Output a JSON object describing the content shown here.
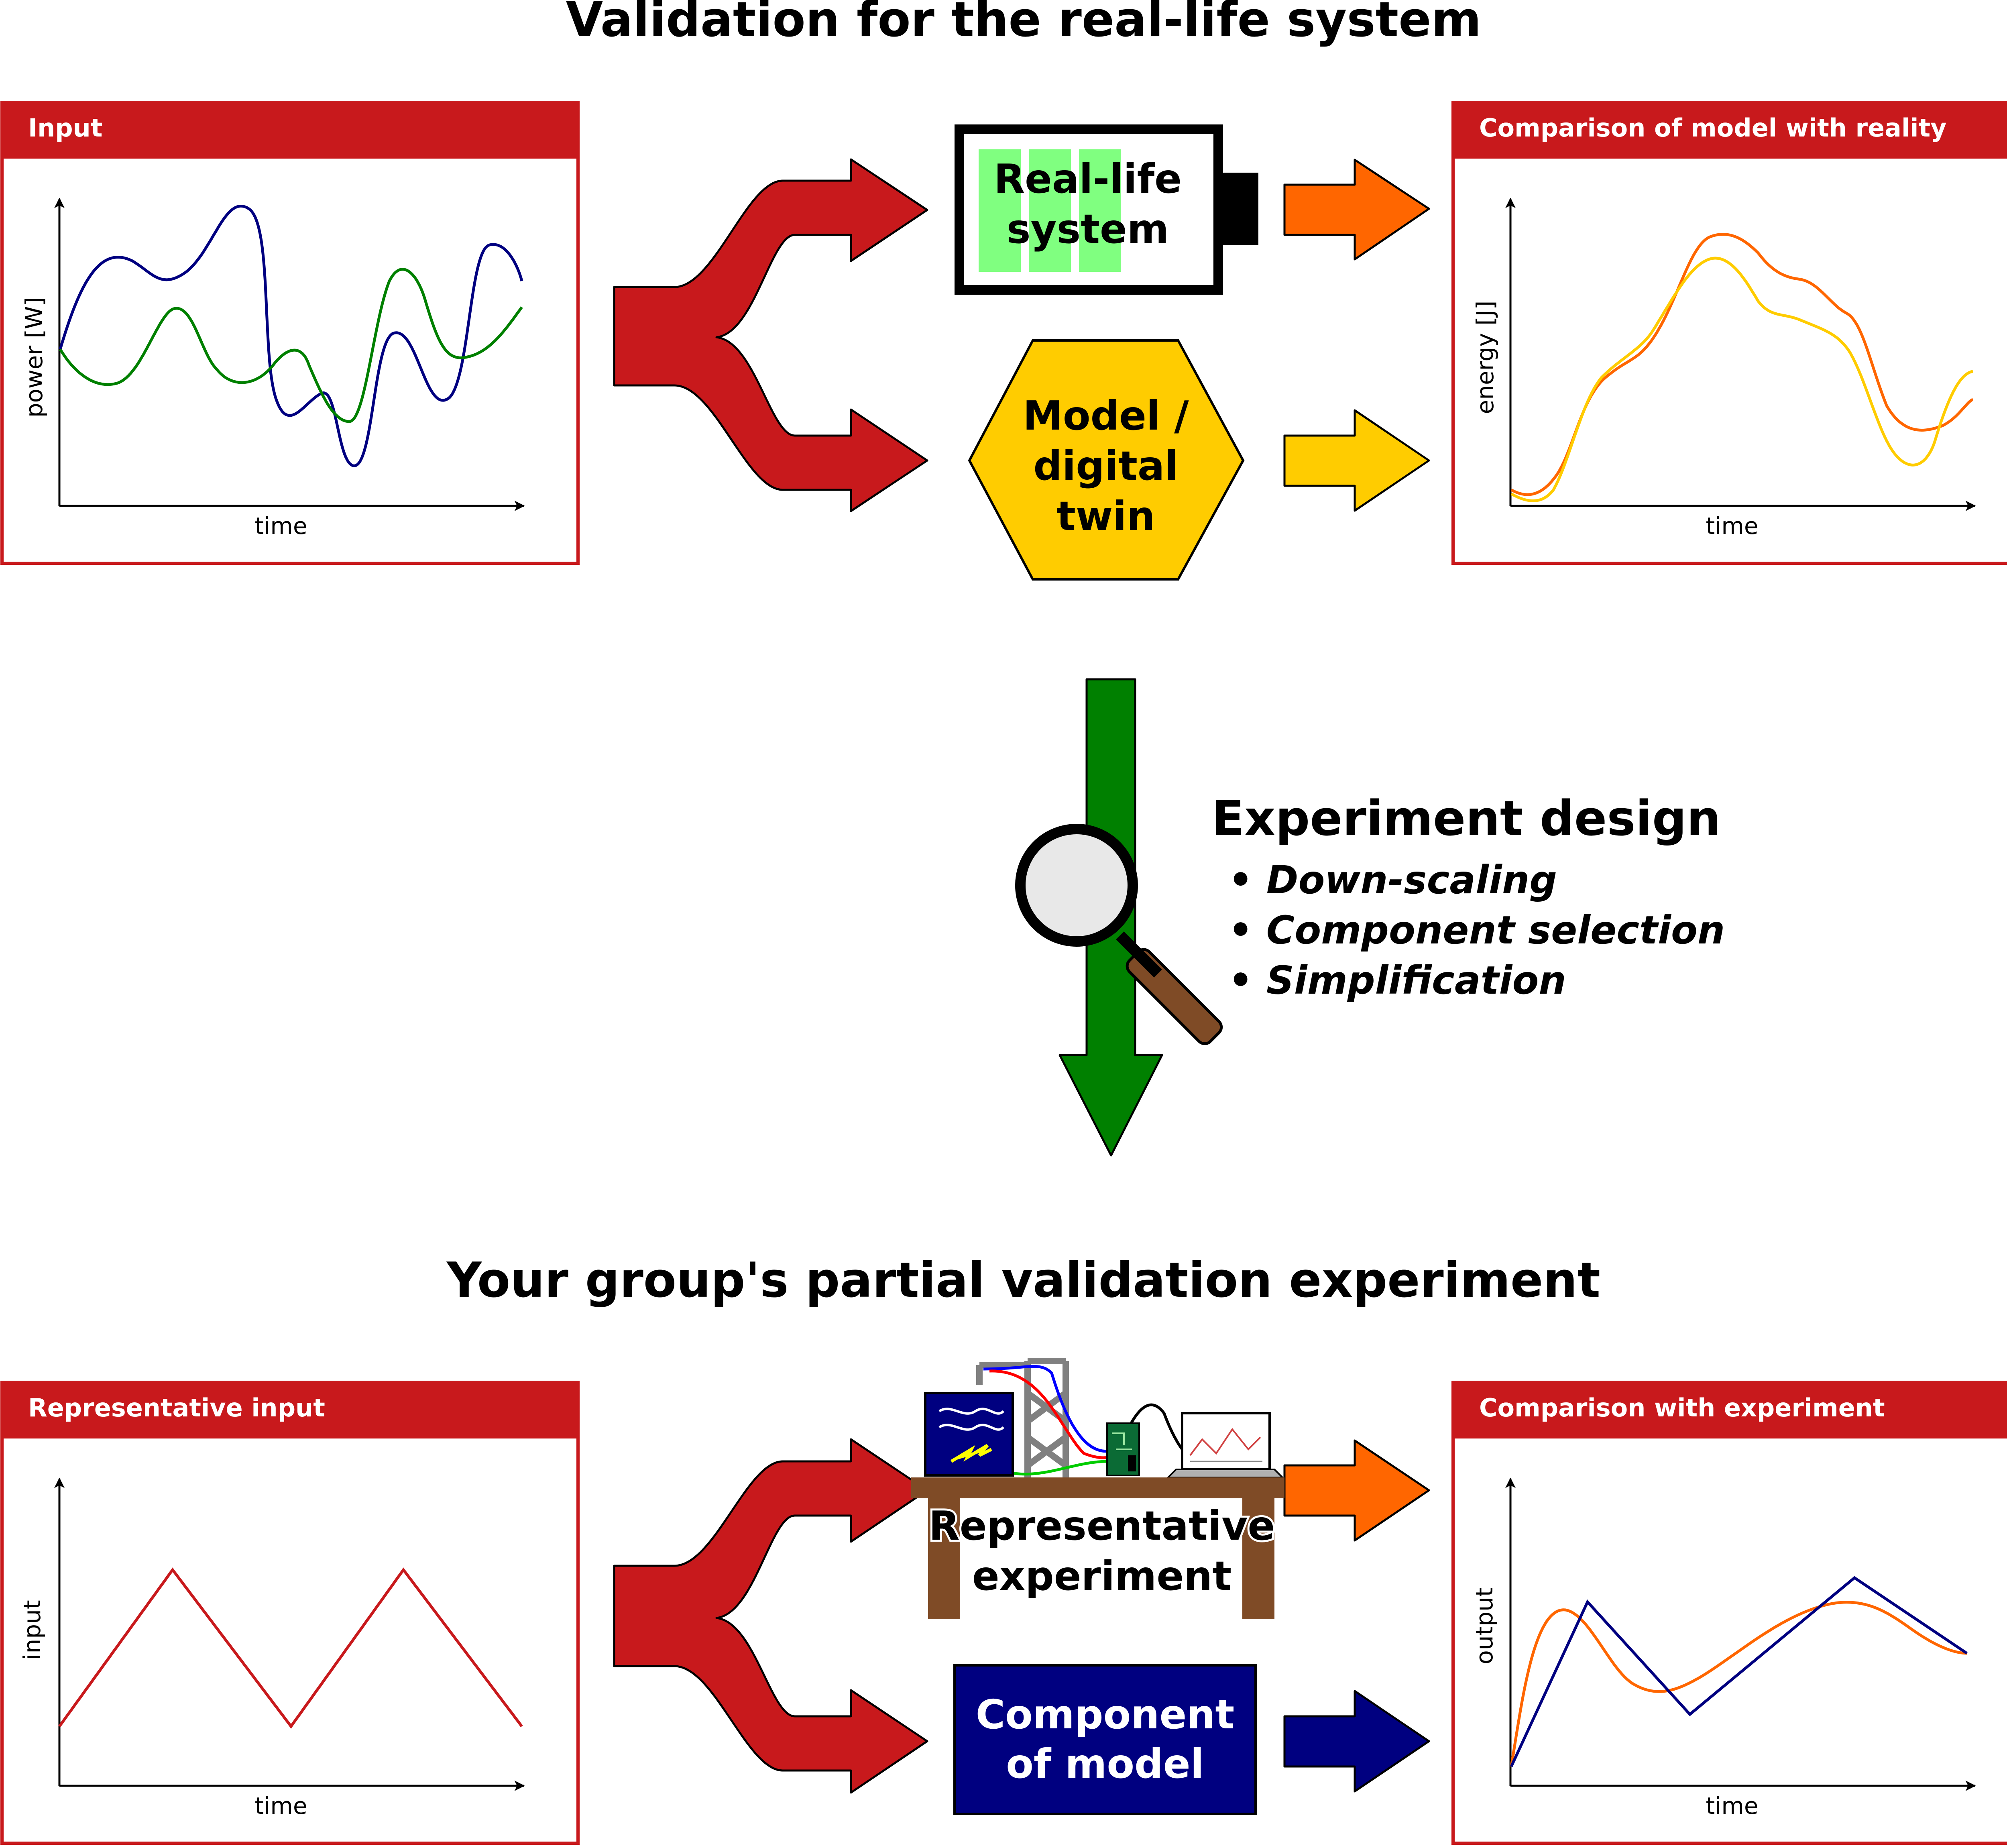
{
  "top_title": "Validation for the real-life system",
  "bottom_title": "Your group's partial validation experiment",
  "panels": {
    "input": {
      "header": "Input",
      "xlabel": "time",
      "ylabel": "power [W]",
      "series_colors": [
        "#000080",
        "#008000"
      ]
    },
    "comparison_reality": {
      "header": "Comparison of model with reality",
      "xlabel": "time",
      "ylabel": "energy [J]",
      "series_colors": [
        "#ff6600",
        "#ffcc00"
      ]
    },
    "representative_input": {
      "header": "Representative input",
      "xlabel": "time",
      "ylabel": "input",
      "series_colors": [
        "#c8191c"
      ]
    },
    "comparison_experiment": {
      "header": "Comparison with experiment",
      "xlabel": "time",
      "ylabel": "output",
      "series_colors": [
        "#ff6600",
        "#000080"
      ]
    }
  },
  "nodes": {
    "real_life": {
      "line1": "Real-life",
      "line2": "system"
    },
    "model": {
      "line1": "Model /",
      "line2": "digital",
      "line3": "twin"
    },
    "experiment": {
      "line1": "Representative",
      "line2": "experiment"
    },
    "component": {
      "line1": "Component",
      "line2": "of model"
    }
  },
  "experiment_design": {
    "heading": "Experiment design",
    "bullets": [
      "• Down-scaling",
      "• Component selection",
      "• Simplification"
    ]
  },
  "colors": {
    "header_red": "#c8191c",
    "fork_red": "#c8191c",
    "orange_arrow": "#ff6600",
    "yellow_arrow": "#ffcc00",
    "navy": "#000080",
    "green_arrow": "#008000",
    "battery_cell": "#80ff80",
    "hexagon": "#ffcc00",
    "table_brown": "#7f4b26"
  },
  "icons": {
    "magnifier": "magnifier-icon",
    "battery": "battery-icon",
    "laptop": "laptop-icon",
    "power-supply": "power-supply-icon"
  }
}
